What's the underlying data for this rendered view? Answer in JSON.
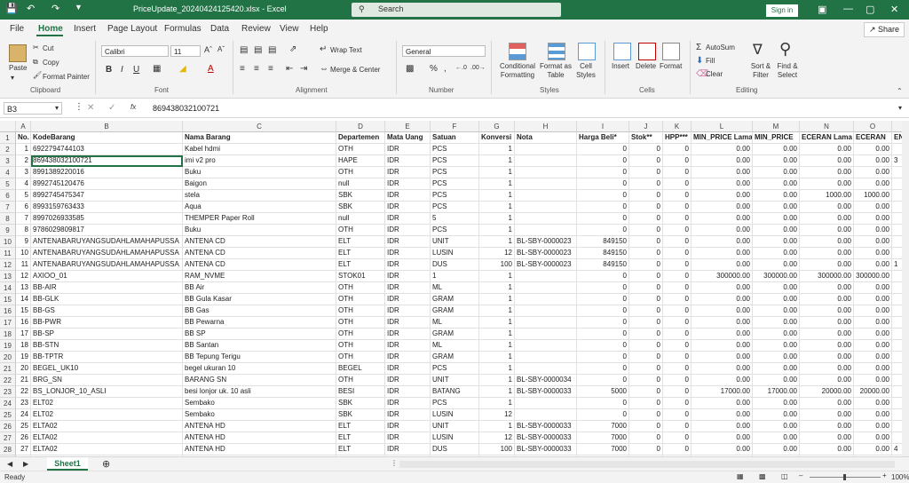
{
  "titlebar": {
    "filename": "PriceUpdate_20240424125420.xlsx",
    "separator": "-",
    "app": "Excel",
    "search_placeholder": "Search",
    "signin": "Sign in"
  },
  "tabs": [
    "File",
    "Home",
    "Insert",
    "Page Layout",
    "Formulas",
    "Data",
    "Review",
    "View",
    "Help"
  ],
  "share_label": "Share",
  "ribbon": {
    "clipboard": {
      "paste": "Paste",
      "cut": "Cut",
      "copy": "Copy",
      "format_painter": "Format Painter",
      "group": "Clipboard"
    },
    "font": {
      "name": "Calibri",
      "size": "11",
      "group": "Font"
    },
    "alignment": {
      "wrap": "Wrap Text",
      "merge": "Merge & Center",
      "group": "Alignment"
    },
    "number": {
      "format": "General",
      "group": "Number"
    },
    "styles": {
      "cond": "Conditional Formatting",
      "table": "Format as Table",
      "cell": "Cell Styles",
      "group": "Styles"
    },
    "cells": {
      "insert": "Insert",
      "delete": "Delete",
      "format": "Format",
      "group": "Cells"
    },
    "editing": {
      "autosum": "AutoSum",
      "fill": "Fill",
      "clear": "Clear",
      "sort": "Sort & Filter",
      "find": "Find & Select",
      "group": "Editing"
    }
  },
  "formula_bar": {
    "name_box": "B3",
    "fx": "fx",
    "content": "869438032100721"
  },
  "columns": [
    "A",
    "B",
    "C",
    "D",
    "E",
    "F",
    "G",
    "H",
    "I",
    "J",
    "K",
    "L",
    "M",
    "N",
    "O"
  ],
  "headers": [
    "No.",
    "KodeBarang",
    "Nama Barang",
    "Departemen",
    "Mata Uang",
    "Satuan",
    "Konversi",
    "Nota",
    "Harga Beli*",
    "Stok**",
    "HPP***",
    "MIN_PRICE Lama",
    "MIN_PRICE",
    "ECERAN Lama",
    "ECERAN",
    "ENDU"
  ],
  "rows": [
    [
      "1",
      "6922794744103",
      "Kabel hdmi",
      "OTH",
      "IDR",
      "PCS",
      "1",
      "",
      "0",
      "0",
      "0",
      "0.00",
      "0.00",
      "0.00",
      "0.00",
      ""
    ],
    [
      "2",
      "869438032100721",
      "imi v2 pro",
      "HAPE",
      "IDR",
      "PCS",
      "1",
      "",
      "0",
      "0",
      "0",
      "0.00",
      "0.00",
      "0.00",
      "0.00",
      "3"
    ],
    [
      "3",
      "8991389220016",
      "Buku",
      "OTH",
      "IDR",
      "PCS",
      "1",
      "",
      "0",
      "0",
      "0",
      "0.00",
      "0.00",
      "0.00",
      "0.00",
      ""
    ],
    [
      "4",
      "8992745120476",
      "Baigon",
      "null",
      "IDR",
      "PCS",
      "1",
      "",
      "0",
      "0",
      "0",
      "0.00",
      "0.00",
      "0.00",
      "0.00",
      ""
    ],
    [
      "5",
      "8992745475347",
      "stela",
      "SBK",
      "IDR",
      "PCS",
      "1",
      "",
      "0",
      "0",
      "0",
      "0.00",
      "0.00",
      "1000.00",
      "1000.00",
      ""
    ],
    [
      "6",
      "8993159763433",
      "Aqua",
      "SBK",
      "IDR",
      "PCS",
      "1",
      "",
      "0",
      "0",
      "0",
      "0.00",
      "0.00",
      "0.00",
      "0.00",
      ""
    ],
    [
      "7",
      "8997026933585",
      "THEMPER Paper Roll",
      "null",
      "IDR",
      "5",
      "1",
      "",
      "0",
      "0",
      "0",
      "0.00",
      "0.00",
      "0.00",
      "0.00",
      ""
    ],
    [
      "8",
      "9786029809817",
      "Buku",
      "OTH",
      "IDR",
      "PCS",
      "1",
      "",
      "0",
      "0",
      "0",
      "0.00",
      "0.00",
      "0.00",
      "0.00",
      ""
    ],
    [
      "9",
      "ANTENABARUYANGSUDAHLAMAHAPUSSA",
      "ANTENA CD",
      "ELT",
      "IDR",
      "UNIT",
      "1",
      "BL-SBY-0000023",
      "849150",
      "0",
      "0",
      "0.00",
      "0.00",
      "0.00",
      "0.00",
      ""
    ],
    [
      "10",
      "ANTENABARUYANGSUDAHLAMAHAPUSSA",
      "ANTENA CD",
      "ELT",
      "IDR",
      "LUSIN",
      "12",
      "BL-SBY-0000023",
      "849150",
      "0",
      "0",
      "0.00",
      "0.00",
      "0.00",
      "0.00",
      ""
    ],
    [
      "11",
      "ANTENABARUYANGSUDAHLAMAHAPUSSA",
      "ANTENA CD",
      "ELT",
      "IDR",
      "DUS",
      "100",
      "BL-SBY-0000023",
      "849150",
      "0",
      "0",
      "0.00",
      "0.00",
      "0.00",
      "0.00",
      "1"
    ],
    [
      "12",
      "AXIOO_01",
      "RAM_NVME",
      "STOK01",
      "IDR",
      "1",
      "1",
      "",
      "0",
      "0",
      "0",
      "300000.00",
      "300000.00",
      "300000.00",
      "300000.00",
      ""
    ],
    [
      "13",
      "BB-AIR",
      "BB Air",
      "OTH",
      "IDR",
      "ML",
      "1",
      "",
      "0",
      "0",
      "0",
      "0.00",
      "0.00",
      "0.00",
      "0.00",
      ""
    ],
    [
      "14",
      "BB-GLK",
      "BB Gula Kasar",
      "OTH",
      "IDR",
      "GRAM",
      "1",
      "",
      "0",
      "0",
      "0",
      "0.00",
      "0.00",
      "0.00",
      "0.00",
      ""
    ],
    [
      "15",
      "BB-GS",
      "BB Gas",
      "OTH",
      "IDR",
      "GRAM",
      "1",
      "",
      "0",
      "0",
      "0",
      "0.00",
      "0.00",
      "0.00",
      "0.00",
      ""
    ],
    [
      "16",
      "BB-PWR",
      "BB Pewarna",
      "OTH",
      "IDR",
      "ML",
      "1",
      "",
      "0",
      "0",
      "0",
      "0.00",
      "0.00",
      "0.00",
      "0.00",
      ""
    ],
    [
      "17",
      "BB-SP",
      "BB SP",
      "OTH",
      "IDR",
      "GRAM",
      "1",
      "",
      "0",
      "0",
      "0",
      "0.00",
      "0.00",
      "0.00",
      "0.00",
      ""
    ],
    [
      "18",
      "BB-STN",
      "BB Santan",
      "OTH",
      "IDR",
      "ML",
      "1",
      "",
      "0",
      "0",
      "0",
      "0.00",
      "0.00",
      "0.00",
      "0.00",
      ""
    ],
    [
      "19",
      "BB-TPTR",
      "BB Tepung Terigu",
      "OTH",
      "IDR",
      "GRAM",
      "1",
      "",
      "0",
      "0",
      "0",
      "0.00",
      "0.00",
      "0.00",
      "0.00",
      ""
    ],
    [
      "20",
      "BEGEL_UK10",
      "begel ukuran 10",
      "BEGEL",
      "IDR",
      "PCS",
      "1",
      "",
      "0",
      "0",
      "0",
      "0.00",
      "0.00",
      "0.00",
      "0.00",
      ""
    ],
    [
      "21",
      "BRG_SN",
      "BARANG SN",
      "OTH",
      "IDR",
      "UNIT",
      "1",
      "BL-SBY-0000034",
      "0",
      "0",
      "0",
      "0.00",
      "0.00",
      "0.00",
      "0.00",
      ""
    ],
    [
      "22",
      "BS_LONJOR_10_ASLI",
      "besi lonjor uk. 10 asli",
      "BESI",
      "IDR",
      "BATANG",
      "1",
      "BL-SBY-0000033",
      "5000",
      "0",
      "0",
      "17000.00",
      "17000.00",
      "20000.00",
      "20000.00",
      ""
    ],
    [
      "23",
      "ELT02",
      "Sembako",
      "SBK",
      "IDR",
      "PCS",
      "1",
      "",
      "0",
      "0",
      "0",
      "0.00",
      "0.00",
      "0.00",
      "0.00",
      ""
    ],
    [
      "24",
      "ELT02",
      "Sembako",
      "SBK",
      "IDR",
      "LUSIN",
      "12",
      "",
      "0",
      "0",
      "0",
      "0.00",
      "0.00",
      "0.00",
      "0.00",
      ""
    ],
    [
      "25",
      "ELTA02",
      "ANTENA HD",
      "ELT",
      "IDR",
      "UNIT",
      "1",
      "BL-SBY-0000033",
      "7000",
      "0",
      "0",
      "0.00",
      "0.00",
      "0.00",
      "0.00",
      ""
    ],
    [
      "26",
      "ELTA02",
      "ANTENA HD",
      "ELT",
      "IDR",
      "LUSIN",
      "12",
      "BL-SBY-0000033",
      "7000",
      "0",
      "0",
      "0.00",
      "0.00",
      "0.00",
      "0.00",
      ""
    ],
    [
      "27",
      "ELTA02",
      "ANTENA HD",
      "ELT",
      "IDR",
      "DUS",
      "100",
      "BL-SBY-0000033",
      "7000",
      "0",
      "0",
      "0.00",
      "0.00",
      "0.00",
      "0.00",
      "4"
    ],
    [
      "28",
      "ELTP01",
      "BLENDER PHILIPS",
      "ELT",
      "IDR",
      "UNIT",
      "1",
      "",
      "0",
      "0",
      "0",
      "0.00",
      "0.00",
      "0.00",
      "0.00",
      ""
    ]
  ],
  "sheet_tab": "Sheet1",
  "status": {
    "ready": "Ready",
    "zoom": "100%"
  },
  "colors": {
    "accent": "#217346"
  }
}
